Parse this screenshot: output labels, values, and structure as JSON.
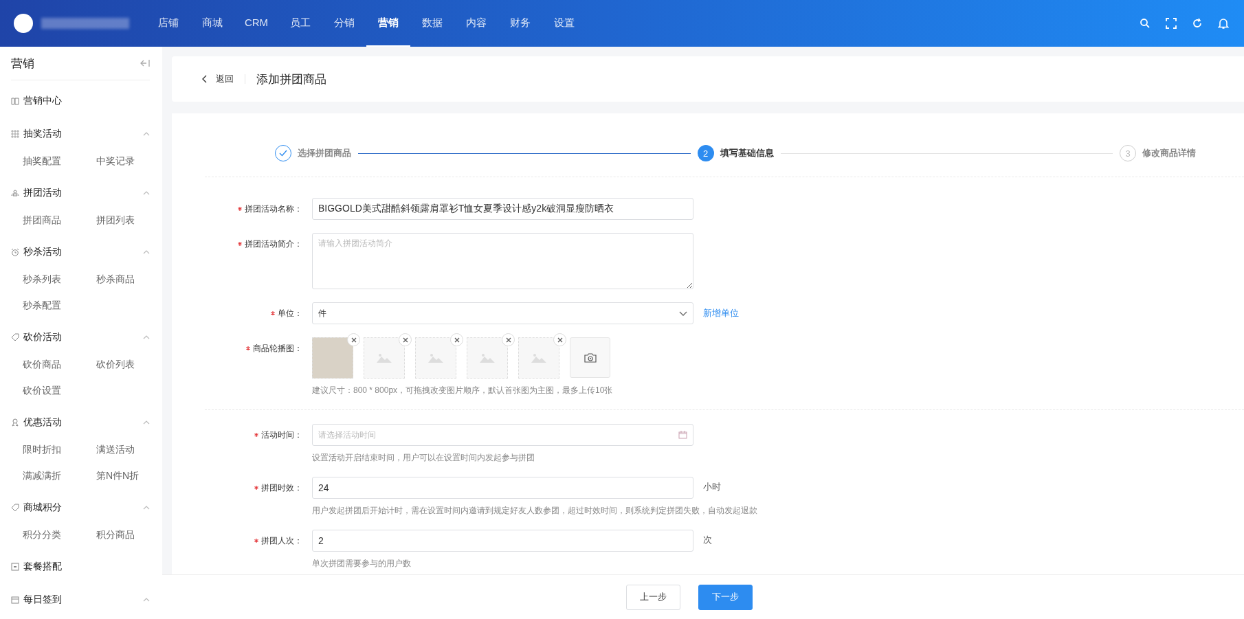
{
  "topbar": {
    "nav": [
      {
        "label": "店铺",
        "selected": false
      },
      {
        "label": "商城",
        "selected": false
      },
      {
        "label": "CRM",
        "selected": false
      },
      {
        "label": "员工",
        "selected": false
      },
      {
        "label": "分销",
        "selected": false
      },
      {
        "label": "营销",
        "selected": true
      },
      {
        "label": "数据",
        "selected": false
      },
      {
        "label": "内容",
        "selected": false
      },
      {
        "label": "财务",
        "selected": false
      },
      {
        "label": "设置",
        "selected": false
      }
    ]
  },
  "sidebar": {
    "title": "营销",
    "items": [
      {
        "kind": "link",
        "label": "营销中心"
      },
      {
        "kind": "group",
        "label": "抽奖活动",
        "expanded": true,
        "children": [
          "抽奖配置",
          "中奖记录"
        ]
      },
      {
        "kind": "group",
        "label": "拼团活动",
        "expanded": true,
        "children": [
          "拼团商品",
          "拼团列表"
        ]
      },
      {
        "kind": "group",
        "label": "秒杀活动",
        "expanded": true,
        "children": [
          "秒杀列表",
          "秒杀商品",
          "秒杀配置"
        ]
      },
      {
        "kind": "group",
        "label": "砍价活动",
        "expanded": true,
        "children": [
          "砍价商品",
          "砍价列表",
          "砍价设置"
        ]
      },
      {
        "kind": "group",
        "label": "优惠活动",
        "expanded": true,
        "children": [
          "限时折扣",
          "满送活动",
          "满减满折",
          "第N件N折"
        ]
      },
      {
        "kind": "group",
        "label": "商城积分",
        "expanded": true,
        "children": [
          "积分分类",
          "积分商品"
        ]
      },
      {
        "kind": "link",
        "label": "套餐搭配"
      },
      {
        "kind": "group",
        "label": "每日签到",
        "expanded": true
      }
    ]
  },
  "header": {
    "back": "返回",
    "title": "添加拼团商品"
  },
  "steps": [
    {
      "label": "选择拼团商品",
      "done": true,
      "selected": false
    },
    {
      "number": "2",
      "label": "填写基础信息",
      "done": false,
      "selected": true
    },
    {
      "number": "3",
      "label": "修改商品详情",
      "done": false,
      "selected": false
    }
  ],
  "form": [
    {
      "kind": "input",
      "label": "拼团活动名称：",
      "required": true,
      "value": "BIGGOLD美式甜酷斜领露肩罩衫T恤女夏季设计感y2k破洞显瘦防晒衣"
    },
    {
      "kind": "textarea",
      "label": "拼团活动简介：",
      "required": true,
      "placeholder": "请输入拼团活动简介"
    },
    {
      "kind": "select",
      "label": "单位：",
      "required": true,
      "value": "件",
      "link": "新增单位"
    },
    {
      "kind": "images",
      "label": "商品轮播图：",
      "required": true,
      "images": [
        {
          "kind": "photo"
        },
        {
          "kind": "empty"
        },
        {
          "kind": "empty"
        },
        {
          "kind": "empty"
        },
        {
          "kind": "empty"
        }
      ],
      "help": "建议尺寸：800 * 800px，可拖拽改变图片顺序，默认首张图为主图，最多上传10张"
    },
    {
      "kind": "divider"
    },
    {
      "kind": "date",
      "label": "活动时间：",
      "required": true,
      "placeholder": "请选择活动时间",
      "help": "设置活动开启结束时间，用户可以在设置时间内发起参与拼团"
    },
    {
      "kind": "input",
      "label": "拼团时效：",
      "required": true,
      "value": "24",
      "suffix": "小时",
      "help": "用户发起拼团后开始计时，需在设置时间内邀请到规定好友人数参团，超过时效时间，则系统判定拼团失败，自动发起退款"
    },
    {
      "kind": "input",
      "label": "拼团人次：",
      "required": true,
      "value": "2",
      "suffix": "次",
      "help": "单次拼团需要参与的用户数"
    }
  ],
  "footer": {
    "buttons": [
      {
        "label": "上一步",
        "primary": false
      },
      {
        "label": "下一步",
        "primary": true
      }
    ]
  }
}
